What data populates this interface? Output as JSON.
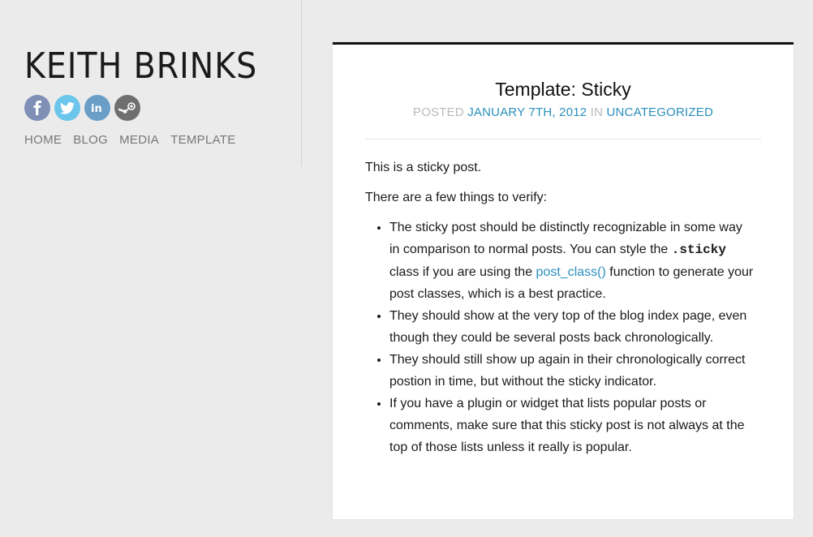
{
  "site": {
    "title": "KEITH BRINKS",
    "social": [
      {
        "name": "facebook",
        "icon": "facebook-icon",
        "color": "#7f8fb6"
      },
      {
        "name": "twitter",
        "icon": "twitter-icon",
        "color": "#6cc5eb"
      },
      {
        "name": "linkedin",
        "icon": "linkedin-icon",
        "color": "#6a9ec7"
      },
      {
        "name": "steam",
        "icon": "steam-icon",
        "color": "#6f6f6f"
      }
    ],
    "nav": [
      "HOME",
      "BLOG",
      "MEDIA",
      "TEMPLATE"
    ]
  },
  "post": {
    "title": "Template: Sticky",
    "meta": {
      "posted_label": "POSTED",
      "date": "JANUARY 7TH, 2012",
      "in_label": "IN",
      "category": "UNCATEGORIZED"
    },
    "paragraphs": [
      "This is a sticky post.",
      "There are a few things to verify:"
    ],
    "list": {
      "item1": {
        "before": "The sticky post should be distinctly recognizable in some way in comparison to normal posts. You can style the",
        "code": ".sticky",
        "middle": "class if you are using the",
        "link": "post_class()",
        "after": "function to generate your post classes, which is a best practice."
      },
      "item2": "They should show at the very top of the blog index page, even though they could be several posts back chronologically.",
      "item3": "They should still show up again in their chronologically correct postion in time, but without the sticky indicator.",
      "item4": "If you have a plugin or widget that lists popular posts or comments, make sure that this sticky post is not always at the top of those lists unless it really is popular."
    },
    "colors": {
      "link": "#2a8fbd",
      "meta": "#bbbbbb",
      "top_border": "#111111"
    }
  }
}
